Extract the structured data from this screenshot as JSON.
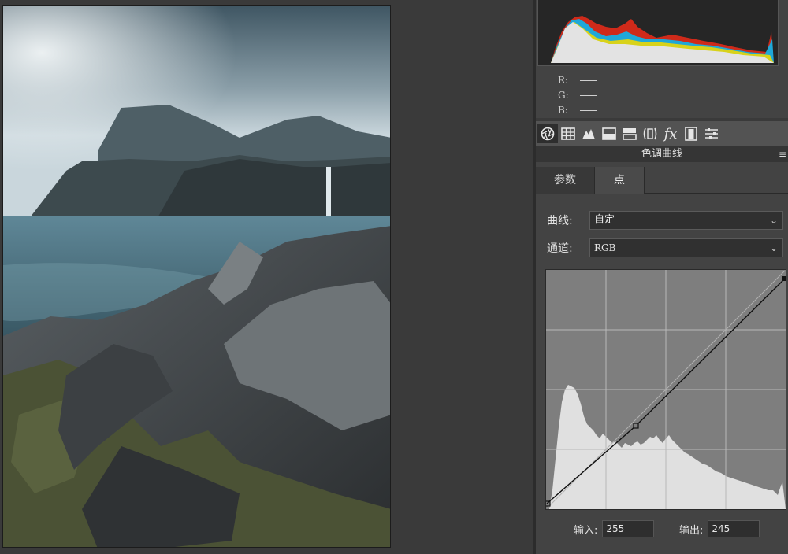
{
  "histogram_readout": {
    "r_label": "R:",
    "g_label": "G:",
    "b_label": "B:"
  },
  "toolbar": {
    "icons": [
      "aperture-icon",
      "grid-icon",
      "mountain-icon",
      "hsl-icon",
      "split-tone-icon",
      "lens-icon",
      "fx-icon",
      "filmstrip-icon",
      "sliders-icon"
    ],
    "active_index": 0
  },
  "panel": {
    "title": "色调曲线",
    "menu_glyph": "≡",
    "tabs": [
      {
        "label": "参数"
      },
      {
        "label": "点"
      }
    ],
    "active_tab": 1
  },
  "curve": {
    "label": "曲线:",
    "value": "自定",
    "channel_label": "通道:",
    "channel_value": "RGB",
    "input_label": "输入:",
    "input_value": "255",
    "output_label": "输出:",
    "output_value": "245"
  },
  "colors": {
    "panel_bg": "#434343",
    "curve_bg": "#7e7e7e",
    "histogram_fill": "#e0e0e0"
  }
}
